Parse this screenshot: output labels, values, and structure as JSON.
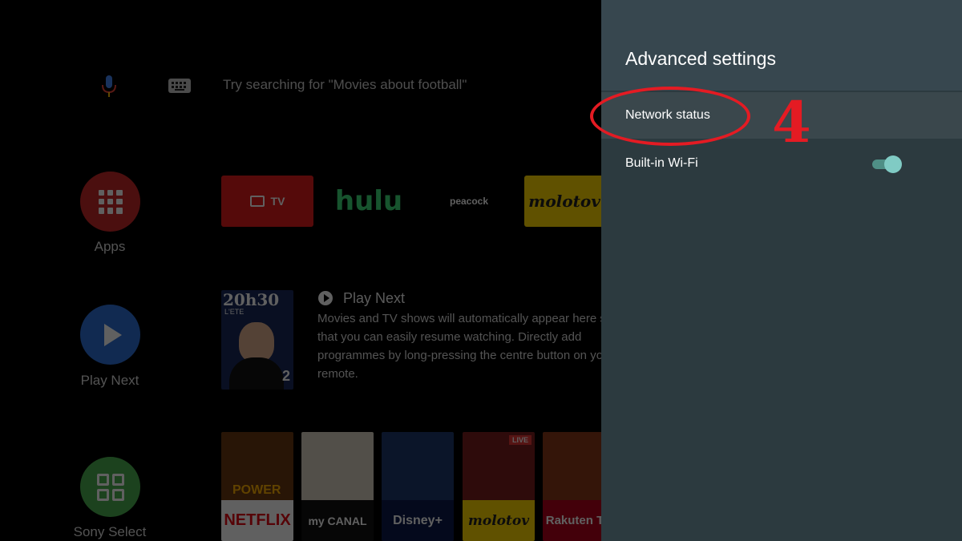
{
  "home": {
    "search_hint": "Try searching for \"Movies about football\"",
    "sidebar": [
      {
        "label": "Apps",
        "icon": "apps-grid-icon",
        "color": "#c62828"
      },
      {
        "label": "Play Next",
        "icon": "play-icon",
        "color": "#2f6fd6"
      },
      {
        "label": "Sony Select",
        "icon": "sony-select-icon",
        "color": "#4caf50"
      }
    ],
    "apps_row": [
      {
        "label": "TV"
      },
      {
        "label": "hulu"
      },
      {
        "label": "peacock"
      },
      {
        "label": "molotov"
      }
    ],
    "play_next": {
      "title": "Play Next",
      "description": "Movies and TV shows will automatically appear here so that you can easily resume watching. Directly add programmes by long-pressing the centre button on your remote.",
      "poster_title": "20h30",
      "poster_sub": "L'ETE",
      "poster_channel": "2"
    },
    "content_row": [
      {
        "label": "NETFLIX",
        "overlay": "POWER"
      },
      {
        "label": "my CANAL"
      },
      {
        "label": "Disney+"
      },
      {
        "label": "molotov",
        "badge": "LIVE"
      },
      {
        "label": "Rakuten TV"
      }
    ]
  },
  "settings": {
    "title": "Advanced settings",
    "items": [
      {
        "label": "Network status"
      },
      {
        "label": "Built-in Wi-Fi",
        "toggle_on": true
      }
    ],
    "accent_color": "#80cbc4"
  },
  "annotation": {
    "step_number": "4",
    "color": "#e41b23"
  }
}
